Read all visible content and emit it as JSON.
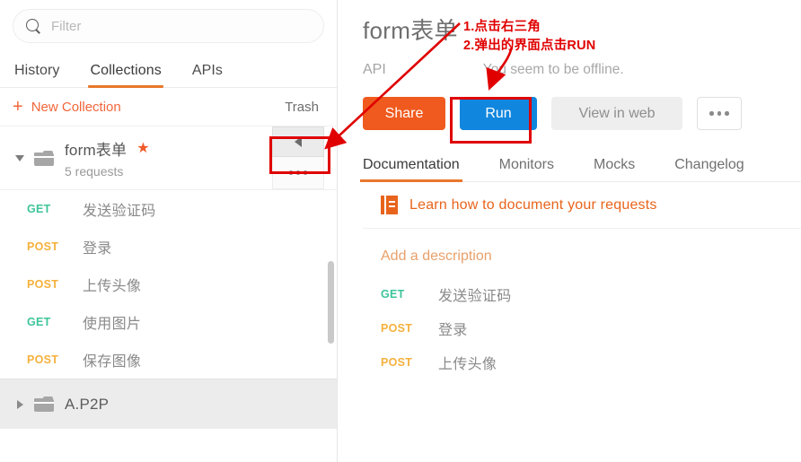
{
  "sidebar": {
    "search": {
      "icon": "search-icon",
      "placeholder": "Filter",
      "value": ""
    },
    "tabs": [
      {
        "label": "History",
        "active": false
      },
      {
        "label": "Collections",
        "active": true
      },
      {
        "label": "APIs",
        "active": false
      }
    ],
    "actions": {
      "new_collection_label": "New Collection",
      "new_collection_icon": "plus-icon",
      "trash_label": "Trash"
    },
    "collection": {
      "name": "form表单",
      "starred": true,
      "star_icon": "star-icon",
      "folder_icon": "folder-icon",
      "caret_icon": "caret-down-icon",
      "request_count_label": "5 requests",
      "collapse_button_icon": "triangle-left-icon",
      "more_button_icon": "ellipsis-icon"
    },
    "requests": [
      {
        "method": "GET",
        "name": "发送验证码"
      },
      {
        "method": "POST",
        "name": "登录"
      },
      {
        "method": "POST",
        "name": "上传头像"
      },
      {
        "method": "GET",
        "name": "使用图片"
      },
      {
        "method": "POST",
        "name": "保存图像"
      }
    ],
    "next_folder": {
      "name": "A.P2P",
      "caret_icon": "caret-right-icon",
      "folder_icon": "folder-icon"
    }
  },
  "main": {
    "title": "form表单",
    "meta": {
      "type_label": "API",
      "status_label": "You seem to be offline."
    },
    "buttons": {
      "share": "Share",
      "run": "Run",
      "view_in_web": "View in web",
      "more_icon": "ellipsis-icon"
    },
    "tabs": [
      {
        "label": "Documentation",
        "active": true
      },
      {
        "label": "Monitors",
        "active": false
      },
      {
        "label": "Mocks",
        "active": false
      },
      {
        "label": "Changelog",
        "active": false
      }
    ],
    "learn_link": {
      "icon": "book-icon",
      "label": "Learn how to document your requests"
    },
    "add_description_label": "Add a description",
    "requests": [
      {
        "method": "GET",
        "name": "发送验证码"
      },
      {
        "method": "POST",
        "name": "登录"
      },
      {
        "method": "POST",
        "name": "上传头像"
      }
    ]
  },
  "annotations": {
    "step1": "1.点击右三角",
    "step2": "2.弹出的界面点击RUN",
    "color": "#e00000"
  },
  "colors": {
    "accent_orange": "#e8772c",
    "share_orange": "#f05a1e",
    "run_blue": "#1186de",
    "get_green": "#3ec49a",
    "post_yellow": "#f5b13d",
    "star_orange": "#f05a28",
    "annotation_red": "#e00000"
  }
}
